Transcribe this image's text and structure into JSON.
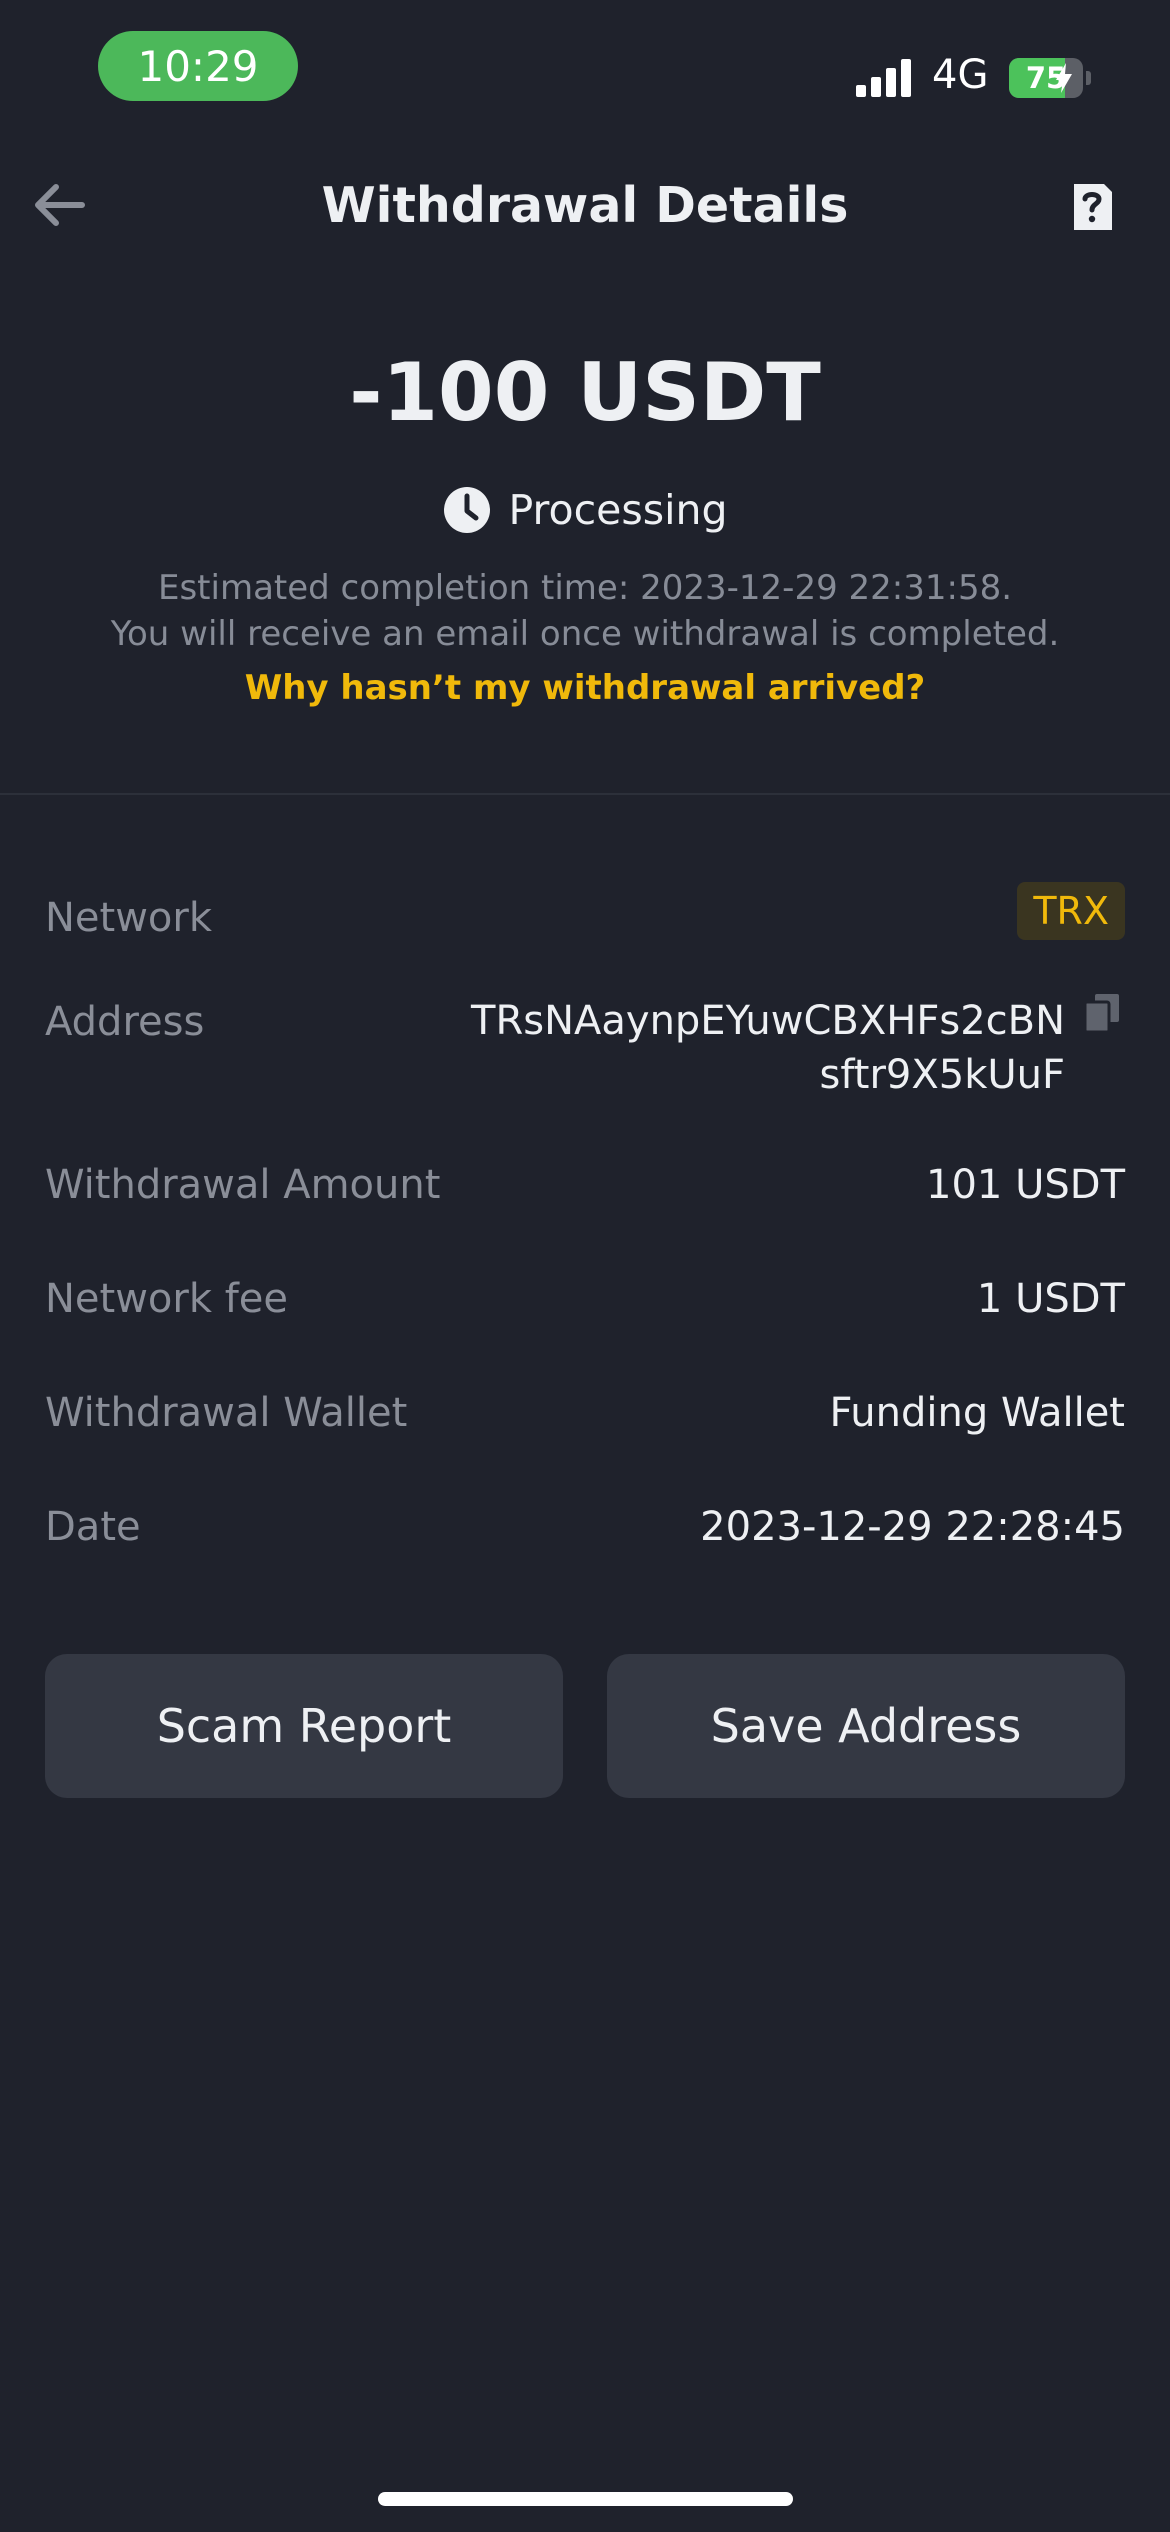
{
  "status_bar": {
    "time": "10:29",
    "network": "4G",
    "battery_level": "75",
    "battery_fraction": 0.75,
    "pill_color": "#4cb85a"
  },
  "nav": {
    "title": "Withdrawal Details",
    "back_icon": "arrow-left-icon",
    "help_icon": "help-document-icon"
  },
  "summary": {
    "amount": "-100 USDT",
    "status": "Processing",
    "status_icon": "clock-icon",
    "eta_note": "Estimated completion time: 2023-12-29 22:31:58.",
    "email_note": "You will receive an email once withdrawal is completed.",
    "help_link": "Why hasn’t my withdrawal arrived?",
    "accent_color": "#f0b90b"
  },
  "details": {
    "network_label": "Network",
    "network_value": "TRX",
    "address_label": "Address",
    "address_value": "TRsNAaynpEYuwCBXHFs2cBNsftr9X5kUuF",
    "amount_label": "Withdrawal Amount",
    "amount_value": "101 USDT",
    "fee_label": "Network fee",
    "fee_value": "1 USDT",
    "wallet_label": "Withdrawal Wallet",
    "wallet_value": "Funding Wallet",
    "date_label": "Date",
    "date_value": "2023-12-29 22:28:45"
  },
  "actions": {
    "scam_report": "Scam Report",
    "save_address": "Save Address"
  }
}
